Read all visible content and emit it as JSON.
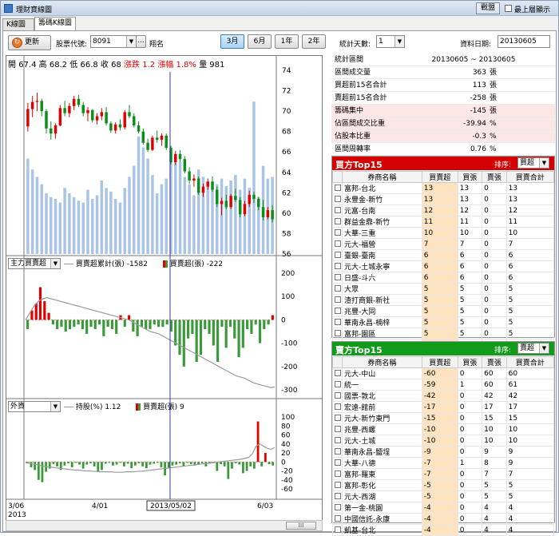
{
  "window": {
    "title": "理財寶線圖"
  },
  "titlebar": {
    "save_label": "戰盟",
    "ontop_label": "最上層顯示"
  },
  "tabs": [
    {
      "label": "K線圖"
    },
    {
      "label": "籌碼K線圖"
    }
  ],
  "toolbar": {
    "refresh_label": "更新",
    "code_label": "股票代號:",
    "code_value": "8091",
    "more_label": "...",
    "stock_name": "翔名",
    "ranges": [
      "3月",
      "6月",
      "1年",
      "2年"
    ],
    "selected_range": "3月",
    "stat_days_label": "統計天數:",
    "stat_days_value": "1",
    "date_label": "資料日期:",
    "date_value": "20130605"
  },
  "price_panel": {
    "open_label": "開",
    "open": "67.4",
    "high_label": "高",
    "high": "68.2",
    "low_label": "低",
    "low": "66.8",
    "close_label": "收",
    "close": "68",
    "change_label": "漲跌",
    "change": "1.2",
    "pct_label": "漲幅",
    "pct": "1.8%",
    "vol_label": "量",
    "vol": "981"
  },
  "major_panel": {
    "combo": "主力買賣超",
    "line_label": "買賣超累計(張)",
    "line_value": "-1582",
    "bar_label": "買賣超(張)",
    "bar_value": "-222"
  },
  "foreign_panel": {
    "combo": "外資",
    "line_label": "持股(%)",
    "line_value": "1.12",
    "bar_label": "買賣超(張)",
    "bar_value": "9"
  },
  "x_axis": {
    "labels": [
      "3/06",
      "4/01",
      "6/03"
    ],
    "year": "2013",
    "cursor_date": "2013/05/02"
  },
  "stats": [
    {
      "k": "統計區間",
      "v": "20130605 ~ 20130605",
      "u": ""
    },
    {
      "k": "區間成交量",
      "v": "363",
      "u": "張"
    },
    {
      "k": "買超前15名合計",
      "v": "113",
      "u": "張"
    },
    {
      "k": "賣超前15名合計",
      "v": "-258",
      "u": "張"
    },
    {
      "k": "籌碼集中",
      "v": "-145",
      "u": "張"
    },
    {
      "k": "佔區間成交比重",
      "v": "-39.94",
      "u": "%"
    },
    {
      "k": "佔股本比重",
      "v": "-0.3",
      "u": "%"
    },
    {
      "k": "區間周轉率",
      "v": "0.76",
      "u": "%"
    }
  ],
  "buy_table": {
    "title": "買方Top15",
    "sort_label": "排序:",
    "sort_value": "買超",
    "headers": [
      "券商名稱",
      "買賣超",
      "買張",
      "賣張",
      "買賣合計"
    ],
    "rows": [
      [
        "富邦-台北",
        "13",
        "13",
        "0",
        "13"
      ],
      [
        "永豐金-新竹",
        "13",
        "13",
        "0",
        "13"
      ],
      [
        "元富-台南",
        "12",
        "12",
        "0",
        "12"
      ],
      [
        "群益金鼎-新竹",
        "11",
        "11",
        "0",
        "11"
      ],
      [
        "大華-三重",
        "10",
        "10",
        "0",
        "10"
      ],
      [
        "元大-福營",
        "7",
        "7",
        "0",
        "7"
      ],
      [
        "臺銀-臺南",
        "6",
        "6",
        "0",
        "6"
      ],
      [
        "元大-土城永寧",
        "6",
        "6",
        "0",
        "6"
      ],
      [
        "日盛-斗六",
        "6",
        "6",
        "0",
        "6"
      ],
      [
        "大眾",
        "5",
        "5",
        "0",
        "5"
      ],
      [
        "渣打商銀-新社",
        "5",
        "5",
        "0",
        "5"
      ],
      [
        "兆豐-大同",
        "5",
        "5",
        "0",
        "5"
      ],
      [
        "華南永昌-楠梓",
        "5",
        "5",
        "0",
        "5"
      ],
      [
        "富邦-園區",
        "5",
        "5",
        "0",
        "5"
      ],
      [
        "富邦-竹東",
        "5",
        "6",
        "1",
        "7"
      ]
    ]
  },
  "sell_table": {
    "title": "賣方Top15",
    "sort_label": "排序:",
    "sort_value": "賣超",
    "headers": [
      "券商名稱",
      "買賣超",
      "買張",
      "賣張",
      "買賣合計"
    ],
    "rows": [
      [
        "元大-中山",
        "-60",
        "0",
        "60",
        "60"
      ],
      [
        "統一",
        "-59",
        "1",
        "60",
        "61"
      ],
      [
        "國票-敦北",
        "-42",
        "0",
        "42",
        "42"
      ],
      [
        "宏遠-館前",
        "-17",
        "0",
        "17",
        "17"
      ],
      [
        "元大-新竹東門",
        "-15",
        "0",
        "15",
        "15"
      ],
      [
        "兆豐-西螺",
        "-10",
        "0",
        "10",
        "10"
      ],
      [
        "元大-土城",
        "-10",
        "0",
        "10",
        "10"
      ],
      [
        "華南永昌-鹽埕",
        "-9",
        "0",
        "9",
        "9"
      ],
      [
        "大華-八德",
        "-7",
        "1",
        "8",
        "9"
      ],
      [
        "富邦-羅東",
        "-7",
        "0",
        "7",
        "7"
      ],
      [
        "富邦-彰化",
        "-5",
        "0",
        "5",
        "5"
      ],
      [
        "元大-西湖",
        "-5",
        "0",
        "5",
        "5"
      ],
      [
        "第一金-桃園",
        "-4",
        "0",
        "4",
        "4"
      ],
      [
        "中國信託-永康",
        "-4",
        "0",
        "4",
        "4"
      ],
      [
        "凱基-台北",
        "-4",
        "0",
        "4",
        "4"
      ]
    ]
  },
  "chart_data": [
    {
      "type": "candlestick",
      "title": "",
      "ylim": [
        56,
        74
      ],
      "yticks": [
        56,
        58,
        60,
        62,
        64,
        66,
        68,
        70,
        72,
        74
      ],
      "ohlc": [
        [
          68.5,
          70.8,
          68.0,
          70.2
        ],
        [
          70.2,
          71.5,
          69.4,
          70.9
        ],
        [
          70.9,
          71.8,
          70.0,
          71.0
        ],
        [
          71.0,
          71.2,
          69.5,
          70.0
        ],
        [
          70.0,
          70.2,
          67.8,
          68.3
        ],
        [
          68.3,
          69.0,
          67.2,
          67.8
        ],
        [
          67.8,
          68.8,
          67.3,
          68.6
        ],
        [
          68.6,
          70.6,
          68.5,
          70.3
        ],
        [
          70.3,
          71.0,
          69.5,
          69.8
        ],
        [
          69.8,
          70.8,
          69.4,
          70.5
        ],
        [
          70.5,
          71.5,
          70.1,
          71.2
        ],
        [
          71.2,
          71.6,
          70.4,
          70.6
        ],
        [
          70.6,
          70.9,
          69.5,
          69.8
        ],
        [
          69.8,
          70.4,
          69.0,
          70.1
        ],
        [
          70.1,
          70.2,
          68.9,
          69.1
        ],
        [
          69.1,
          69.8,
          68.7,
          69.5
        ],
        [
          69.5,
          70.3,
          69.1,
          69.9
        ],
        [
          69.9,
          70.4,
          68.6,
          68.8
        ],
        [
          68.8,
          69.0,
          67.9,
          68.1
        ],
        [
          68.1,
          68.9,
          67.8,
          68.7
        ],
        [
          68.7,
          69.2,
          68.1,
          68.4
        ],
        [
          68.4,
          70.1,
          68.2,
          69.9
        ],
        [
          69.9,
          70.6,
          69.3,
          69.5
        ],
        [
          69.5,
          69.8,
          68.4,
          68.6
        ],
        [
          68.6,
          69.0,
          67.8,
          68.0
        ],
        [
          68.0,
          68.3,
          66.7,
          66.9
        ],
        [
          66.9,
          67.3,
          66.0,
          66.2
        ],
        [
          66.2,
          67.6,
          66.1,
          67.4
        ],
        [
          67.4,
          68.1,
          66.9,
          67.2
        ],
        [
          67.2,
          67.8,
          66.6,
          67.6
        ],
        [
          67.6,
          67.8,
          66.2,
          66.4
        ],
        [
          66.4,
          66.6,
          64.8,
          65.0
        ],
        [
          65.0,
          66.1,
          64.7,
          65.8
        ],
        [
          65.8,
          66.2,
          65.0,
          65.3
        ],
        [
          65.3,
          65.6,
          63.9,
          64.1
        ],
        [
          64.1,
          64.5,
          62.9,
          63.2
        ],
        [
          63.2,
          63.8,
          62.6,
          63.4
        ],
        [
          63.4,
          63.6,
          61.8,
          62.0
        ],
        [
          62.0,
          62.9,
          61.6,
          62.6
        ],
        [
          62.6,
          63.4,
          62.3,
          63.1
        ],
        [
          63.1,
          63.6,
          62.1,
          62.3
        ],
        [
          62.3,
          62.6,
          60.6,
          60.9
        ],
        [
          60.9,
          61.5,
          59.8,
          61.2
        ],
        [
          61.2,
          61.8,
          60.4,
          60.6
        ],
        [
          60.6,
          61.9,
          60.4,
          61.7
        ],
        [
          61.7,
          62.4,
          61.1,
          61.3
        ],
        [
          61.3,
          61.6,
          59.6,
          59.9
        ],
        [
          59.9,
          61.2,
          59.7,
          60.9
        ],
        [
          60.9,
          62.2,
          60.6,
          61.8
        ],
        [
          61.8,
          62.1,
          61.0,
          61.4
        ],
        [
          61.4,
          61.6,
          60.3,
          60.6
        ],
        [
          60.6,
          61.3,
          59.3,
          59.6
        ],
        [
          59.6,
          60.6,
          59.4,
          60.3
        ],
        [
          60.3,
          60.8,
          59.1,
          59.4
        ]
      ],
      "volume_scale_max": 1000,
      "volume": [
        520,
        460,
        420,
        380,
        330,
        310,
        300,
        280,
        360,
        330,
        310,
        290,
        280,
        350,
        300,
        320,
        400,
        360,
        340,
        300,
        280,
        360,
        420,
        480,
        640,
        580,
        520,
        430,
        330,
        380,
        410,
        560,
        540,
        500,
        420,
        380,
        320,
        460,
        420,
        390,
        360,
        380,
        410,
        370,
        400,
        430,
        350,
        410,
        360,
        830,
        310,
        480,
        410,
        420
      ]
    },
    {
      "type": "bar+line",
      "title": "",
      "ylim": [
        -300,
        200
      ],
      "yticks": [
        200,
        100,
        0,
        -100,
        -200,
        -300
      ],
      "bars": [
        -40,
        40,
        70,
        140,
        80,
        30,
        -20,
        -40,
        -30,
        -50,
        -40,
        -30,
        -20,
        -40,
        -60,
        -30,
        -40,
        -20,
        -70,
        -30,
        -40,
        -60,
        20,
        -30,
        20,
        -50,
        -70,
        -30,
        -40,
        -40,
        -20,
        -30,
        -30,
        -20,
        -50,
        -110,
        -150,
        -200,
        -80,
        -60,
        -180,
        -150,
        -40,
        -60,
        -110,
        -180,
        -30,
        -120,
        -30,
        -80,
        -160,
        -120,
        -40,
        -60,
        -20,
        -100,
        -40,
        -20,
        20
      ],
      "line": [
        0,
        30,
        60,
        80,
        90,
        95,
        90,
        85,
        80,
        75,
        70,
        65,
        60,
        55,
        50,
        45,
        40,
        35,
        30,
        25,
        20,
        15,
        10,
        5,
        0,
        -10,
        -20,
        -30,
        -40,
        -50,
        -55,
        -60,
        -70,
        -80,
        -90,
        -100,
        -110,
        -120,
        -130,
        -140,
        -150,
        -160,
        -170,
        -180,
        -190,
        -200,
        -210,
        -220,
        -230,
        -240,
        -245,
        -250,
        -260,
        -270,
        -275,
        -280,
        -285,
        -290,
        -288
      ]
    },
    {
      "type": "bar+line",
      "title": "",
      "ylim": [
        -60,
        100
      ],
      "yticks": [
        100,
        80,
        60,
        40,
        20,
        0,
        -20,
        -40,
        -60
      ],
      "bars": [
        -2,
        -12,
        -18,
        -40,
        -45,
        -22,
        -15,
        -5,
        -10,
        -18,
        -8,
        -3,
        -12,
        -2,
        -6,
        -15,
        -6,
        -3,
        -10,
        -22,
        -18,
        -4,
        -2,
        -8,
        -6,
        -2,
        -10,
        -4,
        -14,
        -8,
        -3,
        -10,
        -14,
        -6,
        -4,
        -2,
        -12,
        -30,
        -14,
        -8,
        -6,
        -3,
        -10,
        -2,
        -5,
        -8,
        -6,
        -3,
        -10,
        -4,
        -3,
        -20,
        -5,
        -10,
        -38,
        -15,
        -3,
        -6,
        -25,
        -20,
        -10,
        -15,
        90,
        -10,
        20,
        -5,
        -8
      ],
      "line": [
        -2,
        -3,
        -5,
        -6,
        -8,
        -10,
        -11,
        -12,
        -13,
        -14,
        -15,
        -16,
        -17,
        -18,
        -18,
        -19,
        -20,
        -20,
        -21,
        -21,
        -22,
        -22,
        -22,
        -22,
        -23,
        -23,
        -23,
        -22,
        -22,
        -22,
        -21,
        -21,
        -20,
        -19,
        -18,
        -17,
        -16,
        -15,
        -14,
        -13,
        -12,
        -11,
        -10,
        -9,
        -8,
        -7,
        -6,
        -5,
        -4,
        -3,
        -2,
        -1,
        0,
        1,
        2,
        3,
        4,
        5,
        6,
        8,
        10,
        18,
        35,
        40,
        35,
        30,
        28,
        32
      ]
    }
  ]
}
